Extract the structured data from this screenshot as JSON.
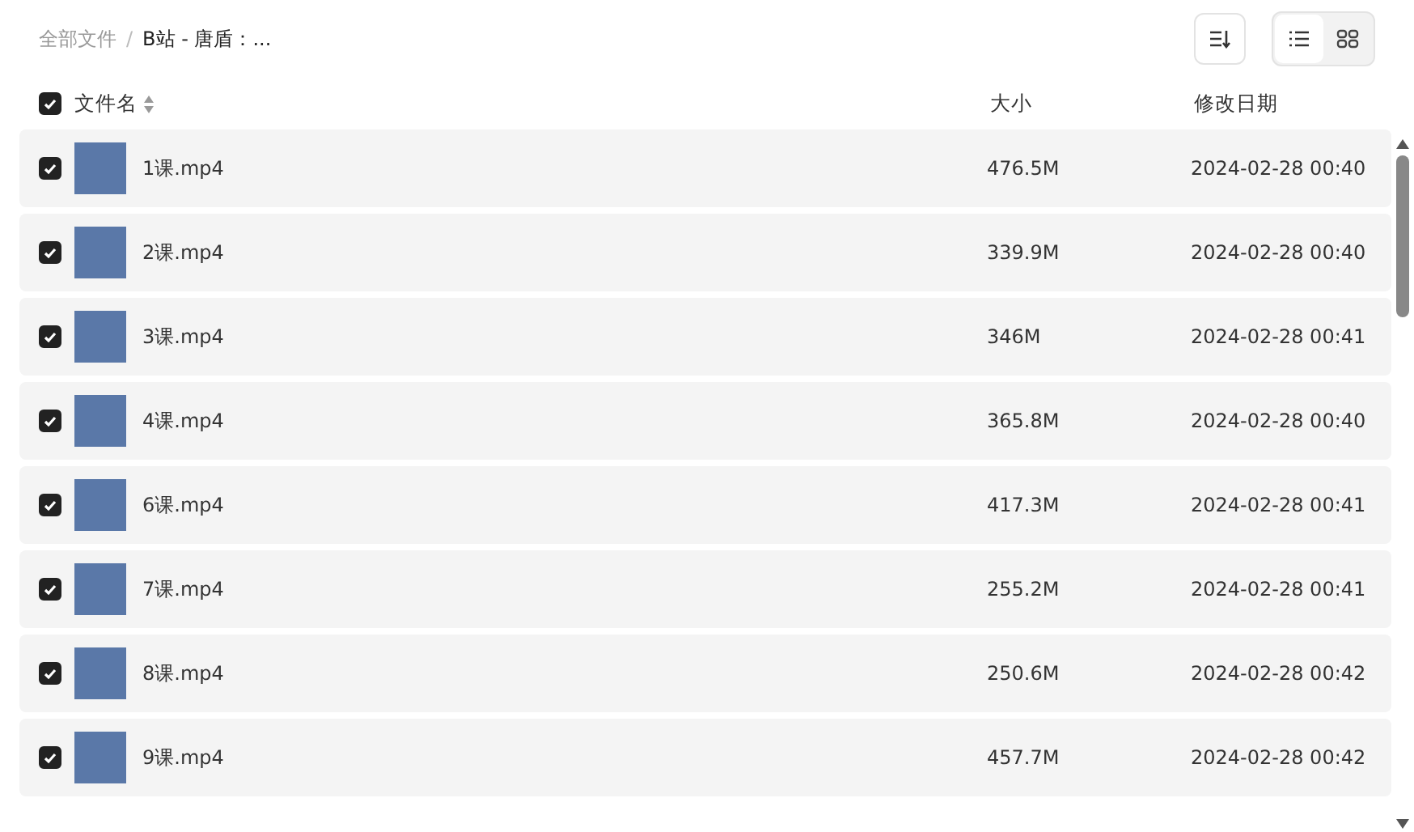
{
  "breadcrumb_separator": "/",
  "breadcrumb": [
    {
      "label": "全部文件",
      "current": false
    },
    {
      "label": "B站 - 唐盾：...",
      "current": true
    }
  ],
  "view_toggle": [
    {
      "kind": "list",
      "selected": true
    },
    {
      "kind": "grid",
      "selected": false
    }
  ],
  "header": {
    "checked": true,
    "name": "文件名",
    "size": "大小",
    "date": "修改日期"
  },
  "rows": [
    {
      "checked": true,
      "name": "1课.mp4",
      "size": "476.5M",
      "date": "2024-02-28 00:40"
    },
    {
      "checked": true,
      "name": "2课.mp4",
      "size": "339.9M",
      "date": "2024-02-28 00:40"
    },
    {
      "checked": true,
      "name": "3课.mp4",
      "size": "346M",
      "date": "2024-02-28 00:41"
    },
    {
      "checked": true,
      "name": "4课.mp4",
      "size": "365.8M",
      "date": "2024-02-28 00:40"
    },
    {
      "checked": true,
      "name": "6课.mp4",
      "size": "417.3M",
      "date": "2024-02-28 00:41"
    },
    {
      "checked": true,
      "name": "7课.mp4",
      "size": "255.2M",
      "date": "2024-02-28 00:41"
    },
    {
      "checked": true,
      "name": "8课.mp4",
      "size": "250.6M",
      "date": "2024-02-28 00:42"
    },
    {
      "checked": true,
      "name": "9课.mp4",
      "size": "457.7M",
      "date": "2024-02-28 00:42"
    }
  ]
}
